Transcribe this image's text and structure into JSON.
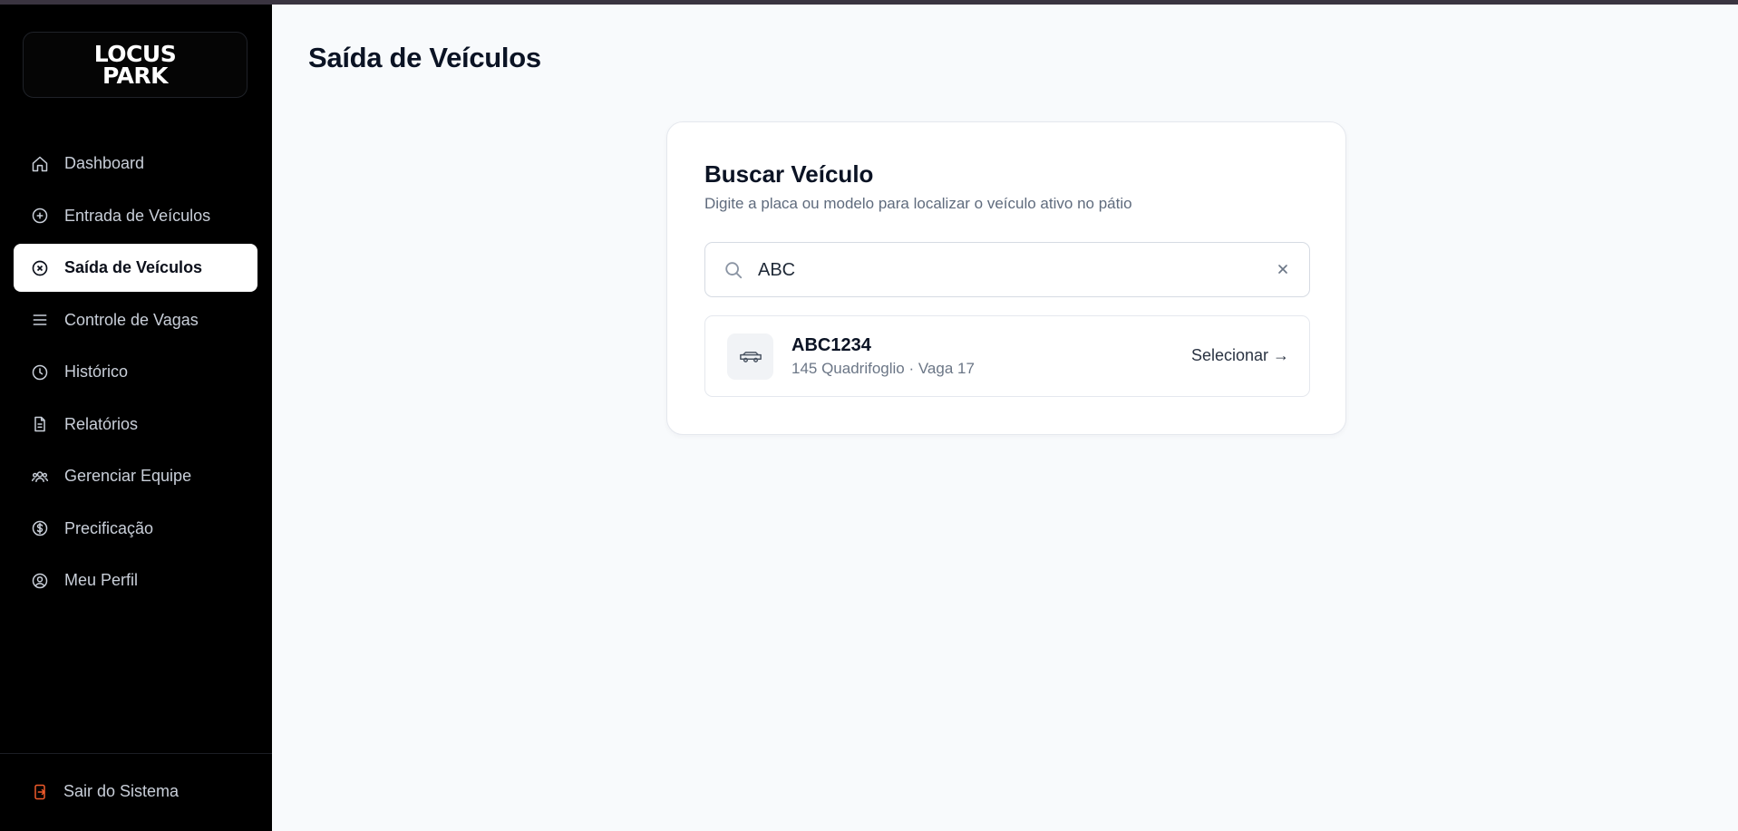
{
  "app": {
    "logo_line1": "LOCUS",
    "logo_line2": "PARK"
  },
  "sidebar": {
    "items": [
      {
        "label": "Dashboard",
        "icon": "home-icon",
        "active": false
      },
      {
        "label": "Entrada de Veículos",
        "icon": "plus-circle-icon",
        "active": false
      },
      {
        "label": "Saída de Veículos",
        "icon": "x-circle-icon",
        "active": true
      },
      {
        "label": "Controle de Vagas",
        "icon": "menu-lines-icon",
        "active": false
      },
      {
        "label": "Histórico",
        "icon": "clock-icon",
        "active": false
      },
      {
        "label": "Relatórios",
        "icon": "document-icon",
        "active": false
      },
      {
        "label": "Gerenciar Equipe",
        "icon": "team-icon",
        "active": false
      },
      {
        "label": "Precificação",
        "icon": "dollar-circle-icon",
        "active": false
      },
      {
        "label": "Meu Perfil",
        "icon": "user-circle-icon",
        "active": false
      }
    ],
    "logout_label": "Sair do Sistema",
    "logout_icon": "logout-icon",
    "logout_color": "#ef5a2a"
  },
  "page": {
    "title": "Saída de Veículos"
  },
  "search_card": {
    "title": "Buscar Veículo",
    "subtitle": "Digite a placa ou modelo para localizar o veículo ativo no pátio",
    "search_value": "ABC",
    "search_icon": "search-icon",
    "clear_icon": "close-icon"
  },
  "results": [
    {
      "plate": "ABC1234",
      "details": "145 Quadrifoglio · Vaga 17",
      "icon": "car-icon",
      "action_label": "Selecionar →"
    }
  ]
}
